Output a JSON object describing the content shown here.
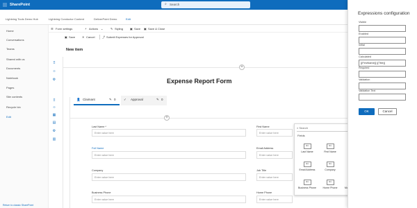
{
  "app": {
    "title": "SharePoint"
  },
  "search": {
    "placeholder": "Search"
  },
  "hub_nav": {
    "items": [
      "Lightning Tools Demo Hub",
      "Lightning Conductor Content",
      "DeliverPoint Demo",
      "Edit"
    ]
  },
  "left_nav": {
    "items": [
      "Home",
      "Conversations",
      "Teams",
      "Shared with us",
      "Documents",
      "Notebook",
      "Pages",
      "Site contents",
      "Recycle bin",
      "Edit"
    ],
    "footer": "Return to classic SharePoint"
  },
  "command_bar": {
    "form_settings": "Form settings",
    "actions": "Actions",
    "styling": "Styling",
    "save": "Save",
    "save_close": "Save & Close"
  },
  "form_actions": {
    "save": "Save",
    "cancel": "Cancel",
    "submit": "Submit Expenses for Approval"
  },
  "page": {
    "new_item": "New item",
    "form_title": "Expense Report Form"
  },
  "tabs": [
    {
      "label": "Claimant",
      "count": "0"
    },
    {
      "label": "Approval",
      "count": "0"
    }
  ],
  "fields": {
    "placeholder": "Enter value here",
    "left": [
      "Last Name *",
      "Full Name",
      "Company",
      "Business Phone"
    ],
    "right": [
      "First Name",
      "Email Address",
      "Job Title",
      "Home Phone"
    ]
  },
  "fields_panel": {
    "search_placeholder": "Search",
    "header": "Fields",
    "icon_text": "Abc",
    "cards": [
      "Last Name",
      "First Name",
      "Full Name",
      "Email Address",
      "Company",
      "Job Title",
      "Business Phone",
      "Home Phone",
      "Mobile Number"
    ]
  },
  "expressions": {
    "title": "Expressions configuration",
    "labels": [
      "Visible",
      "Enabled",
      "Initial",
      "Calculated",
      "Required",
      "Validation",
      "Validation Text"
    ],
    "calculated_value": "[{FirstName}] [{Title}]",
    "ok": "OK",
    "cancel": "Cancel"
  },
  "colors": {
    "brand": "#0f6cbd"
  }
}
